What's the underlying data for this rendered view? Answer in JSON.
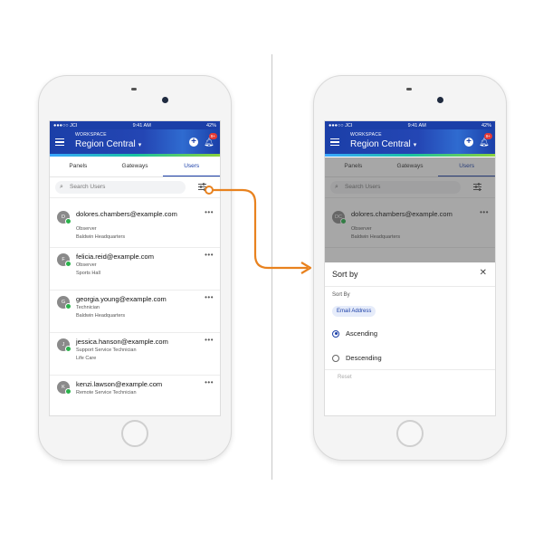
{
  "status_bar": {
    "carrier": "●●●○○ JCI",
    "time": "9:41 AM",
    "battery": "42%"
  },
  "header": {
    "workspace_label": "WORKSPACE",
    "workspace_name": "Region Central",
    "notification_badge": "9+"
  },
  "tabs": [
    {
      "label": "Panels"
    },
    {
      "label": "Gateways"
    },
    {
      "label": "Users",
      "active": true
    }
  ],
  "search": {
    "placeholder": "Search Users"
  },
  "users": [
    {
      "initials": "D",
      "email": "dolores.chambers@example.com",
      "role": "Observer",
      "location": "Baldwin Headquarters"
    },
    {
      "initials": "F",
      "email": "felicia.reid@example.com",
      "role": "Observer",
      "location": "Sports Hall"
    },
    {
      "initials": "G",
      "email": "georgia.young@example.com",
      "role": "Technician",
      "location": "Baldwin Headquarters"
    },
    {
      "initials": "J",
      "email": "jessica.hanson@example.com",
      "role": "Support Service Technician",
      "location": "Life Care"
    },
    {
      "initials": "K",
      "email": "kenzi.lawson@example.com",
      "role": "Remote Service Technician",
      "location": ""
    }
  ],
  "right_user": {
    "initials": "DC",
    "email": "dolores.chambers@example.com",
    "role": "Observer",
    "location": "Baldwin Headquarters"
  },
  "sort_sheet": {
    "title": "Sort by",
    "sort_by_label": "Sort By",
    "chip": "Email Address",
    "options": [
      {
        "label": "Ascending",
        "selected": true
      },
      {
        "label": "Descending",
        "selected": false
      }
    ],
    "reset": "Reset"
  },
  "colors": {
    "brand_blue": "#1b3fa8",
    "arrow_orange": "#e8821f",
    "online_green": "#2bb24c"
  }
}
